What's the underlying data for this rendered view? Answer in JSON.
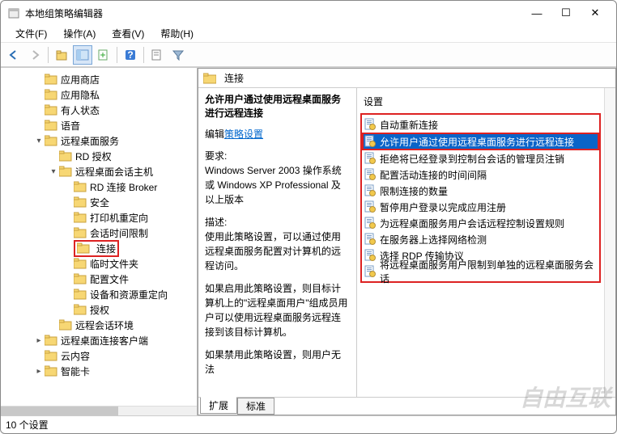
{
  "window": {
    "title": "本地组策略编辑器",
    "controls": {
      "min": "—",
      "max": "☐",
      "close": "✕"
    }
  },
  "menubar": [
    "文件(F)",
    "操作(A)",
    "查看(V)",
    "帮助(H)"
  ],
  "right_header": "连接",
  "tree": [
    {
      "indent": 2,
      "exp": "",
      "label": "应用商店"
    },
    {
      "indent": 2,
      "exp": "",
      "label": "应用隐私"
    },
    {
      "indent": 2,
      "exp": "",
      "label": "有人状态"
    },
    {
      "indent": 2,
      "exp": "",
      "label": "语音"
    },
    {
      "indent": 2,
      "exp": "v",
      "label": "远程桌面服务"
    },
    {
      "indent": 3,
      "exp": "",
      "label": "RD 授权"
    },
    {
      "indent": 3,
      "exp": "v",
      "label": "远程桌面会话主机"
    },
    {
      "indent": 4,
      "exp": "",
      "label": "RD 连接 Broker"
    },
    {
      "indent": 4,
      "exp": "",
      "label": "安全"
    },
    {
      "indent": 4,
      "exp": "",
      "label": "打印机重定向"
    },
    {
      "indent": 4,
      "exp": "",
      "label": "会话时间限制"
    },
    {
      "indent": 4,
      "exp": "",
      "label": "连接",
      "hl": true
    },
    {
      "indent": 4,
      "exp": "",
      "label": "临时文件夹"
    },
    {
      "indent": 4,
      "exp": "",
      "label": "配置文件"
    },
    {
      "indent": 4,
      "exp": "",
      "label": "设备和资源重定向"
    },
    {
      "indent": 4,
      "exp": "",
      "label": "授权"
    },
    {
      "indent": 3,
      "exp": "",
      "label": "远程会话环境"
    },
    {
      "indent": 2,
      "exp": ">",
      "label": "远程桌面连接客户端"
    },
    {
      "indent": 2,
      "exp": "",
      "label": "云内容"
    },
    {
      "indent": 2,
      "exp": ">",
      "label": "智能卡"
    }
  ],
  "desc": {
    "title": "允许用户通过使用远程桌面服务进行远程连接",
    "edit_prefix": "编辑",
    "edit_link": "策略设置",
    "req_label": "要求:",
    "req_text": "Windows Server 2003 操作系统或 Windows XP Professional 及以上版本",
    "desc_label": "描述:",
    "desc_text": "使用此策略设置，可以通过使用远程桌面服务配置对计算机的远程访问。",
    "p2": "如果启用此策略设置，则目标计算机上的\"远程桌面用户\"组成员用户可以使用远程桌面服务远程连接到该目标计算机。",
    "p3": "如果禁用此策略设置，则用户无法"
  },
  "settings_header": "设置",
  "settings": [
    {
      "label": "自动重新连接",
      "sel": false
    },
    {
      "label": "允许用户通过使用远程桌面服务进行远程连接",
      "sel": true
    },
    {
      "label": "拒绝将已经登录到控制台会话的管理员注销",
      "sel": false
    },
    {
      "label": "配置活动连接的时间间隔",
      "sel": false
    },
    {
      "label": "限制连接的数量",
      "sel": false
    },
    {
      "label": "暂停用户登录以完成应用注册",
      "sel": false
    },
    {
      "label": "为远程桌面服务用户会话远程控制设置规则",
      "sel": false
    },
    {
      "label": "在服务器上选择网络检测",
      "sel": false
    },
    {
      "label": "选择 RDP 传输协议",
      "sel": false
    },
    {
      "label": "将远程桌面服务用户限制到单独的远程桌面服务会话",
      "sel": false
    }
  ],
  "tabs": {
    "extended": "扩展",
    "standard": "标准"
  },
  "statusbar": "10 个设置",
  "watermark": "自由互联"
}
